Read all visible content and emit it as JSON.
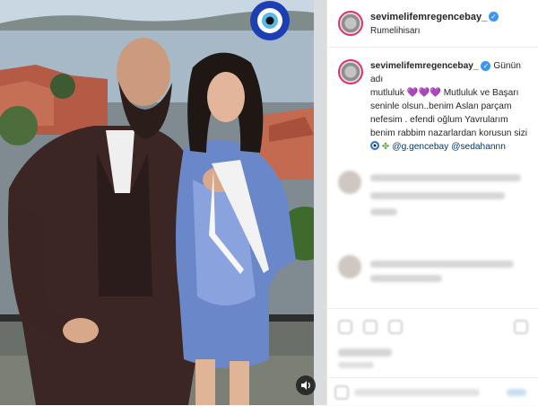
{
  "post": {
    "username": "sevimelifemregencebay_",
    "location": "Rumelihisarı",
    "caption": {
      "author": "sevimelifemregencebay_",
      "line1": "Günün adı",
      "line2": "mutluluk",
      "hearts": "💜💜💜",
      "line2b": "Mutluluk ve Başarı",
      "line3": "seninle olsun..benim Aslan parçam",
      "line4": "nefesim . efendi oğlum Yavrularım",
      "line5": "benim rabbim nazarlardan korusun sizi",
      "mention1": "@g.gencebay",
      "mention2": "@sedahannn"
    }
  },
  "icons": {
    "verified": "verified-badge-icon",
    "evil_eye": "evil-eye-icon",
    "sound": "sound-icon"
  },
  "colors": {
    "accent": "#3897f0",
    "mention": "#00376b",
    "story_ring": "#e1306c"
  }
}
